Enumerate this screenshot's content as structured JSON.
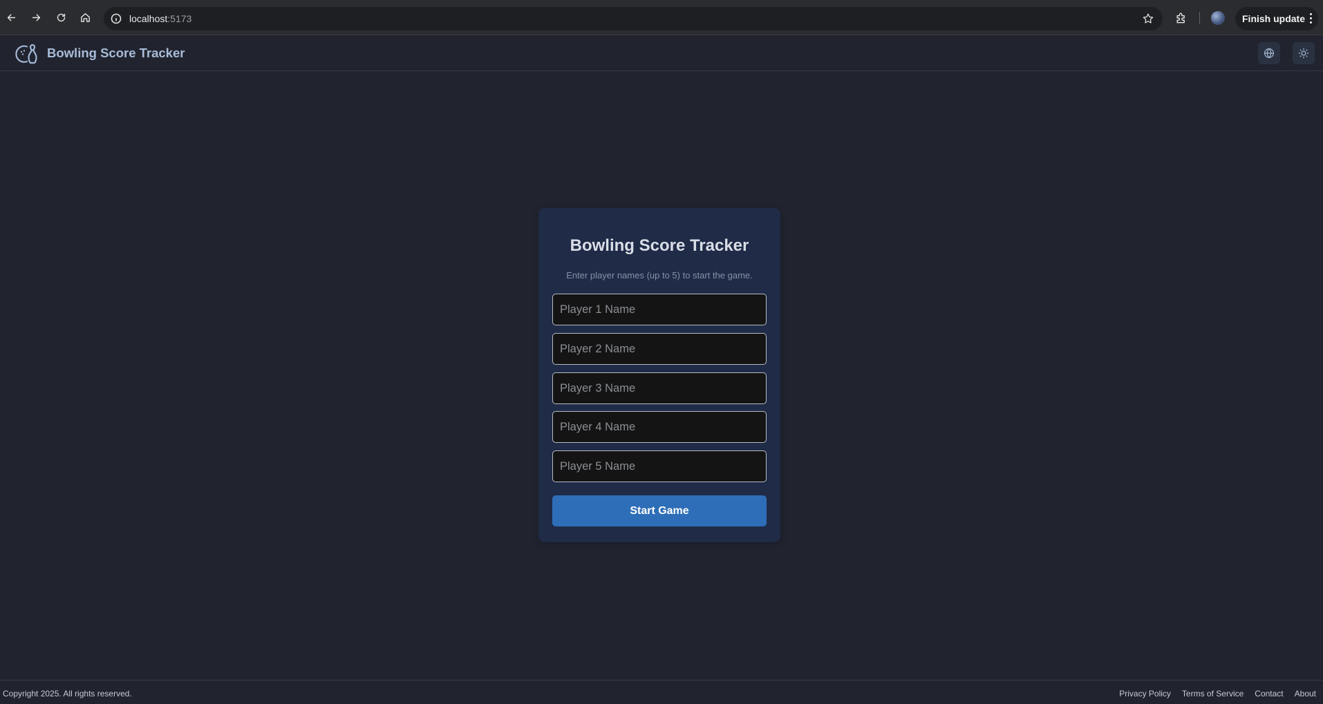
{
  "browser": {
    "url_host": "localhost",
    "url_port": ":5173",
    "update_label": "Finish update",
    "icons": [
      "back-icon",
      "forward-icon",
      "reload-icon",
      "home-icon",
      "site-info-icon",
      "star-icon",
      "extensions-icon",
      "profile-avatar",
      "more-icon"
    ]
  },
  "header": {
    "title": "Bowling Score Tracker",
    "logo_icon": "bowling-icon",
    "language_icon": "globe-icon",
    "theme_icon": "sun-icon"
  },
  "card": {
    "title": "Bowling Score Tracker",
    "subtitle": "Enter player names (up to 5) to start the game.",
    "inputs": [
      {
        "placeholder": "Player 1 Name",
        "value": ""
      },
      {
        "placeholder": "Player 2 Name",
        "value": ""
      },
      {
        "placeholder": "Player 3 Name",
        "value": ""
      },
      {
        "placeholder": "Player 4 Name",
        "value": ""
      },
      {
        "placeholder": "Player 5 Name",
        "value": ""
      }
    ],
    "start_button": "Start Game"
  },
  "footer": {
    "copyright": "Copyright 2025. All rights reserved.",
    "links": [
      "Privacy Policy",
      "Terms of Service",
      "Contact",
      "About"
    ]
  },
  "colors": {
    "page_bg": "#21242f",
    "card_bg": "#1f2b47",
    "accent": "#2e6eb8",
    "header_text": "#a8bcd8"
  }
}
